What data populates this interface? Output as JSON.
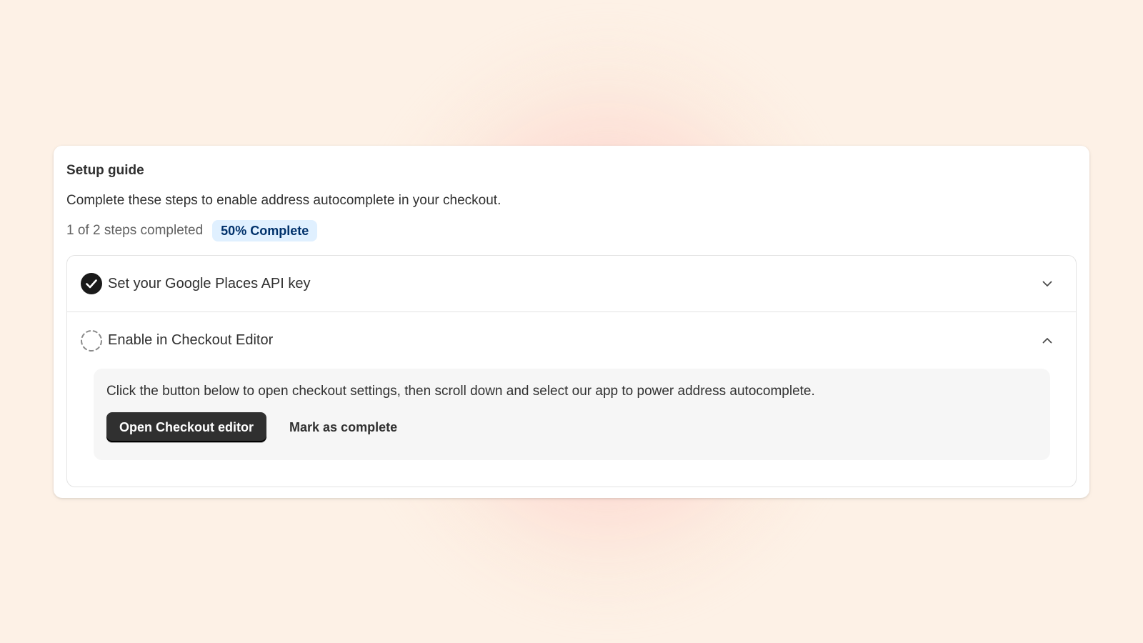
{
  "guide": {
    "title": "Setup guide",
    "subtitle": "Complete these steps to enable address autocomplete in your checkout.",
    "progress_text": "1 of 2 steps completed",
    "progress_badge": "50% Complete",
    "progress_fraction": 0.5
  },
  "steps": [
    {
      "label": "Set your Google Places API key",
      "status": "completed",
      "status_icon": "check-circle-icon",
      "chevron_icon": "chevron-down-icon",
      "expanded": false
    },
    {
      "label": "Enable in Checkout Editor",
      "status": "incomplete",
      "status_icon": "dashed-circle-icon",
      "chevron_icon": "chevron-up-icon",
      "expanded": true,
      "description": "Click the button below to open checkout settings, then scroll down and select our app to power address autocomplete.",
      "primary_action": "Open Checkout editor",
      "secondary_action": "Mark as complete"
    }
  ],
  "colors": {
    "background": "#fdf1e6",
    "glow": "#faaab9",
    "badge_bg": "#e0f0ff",
    "badge_text": "#00316b",
    "primary_button": "#303030"
  }
}
